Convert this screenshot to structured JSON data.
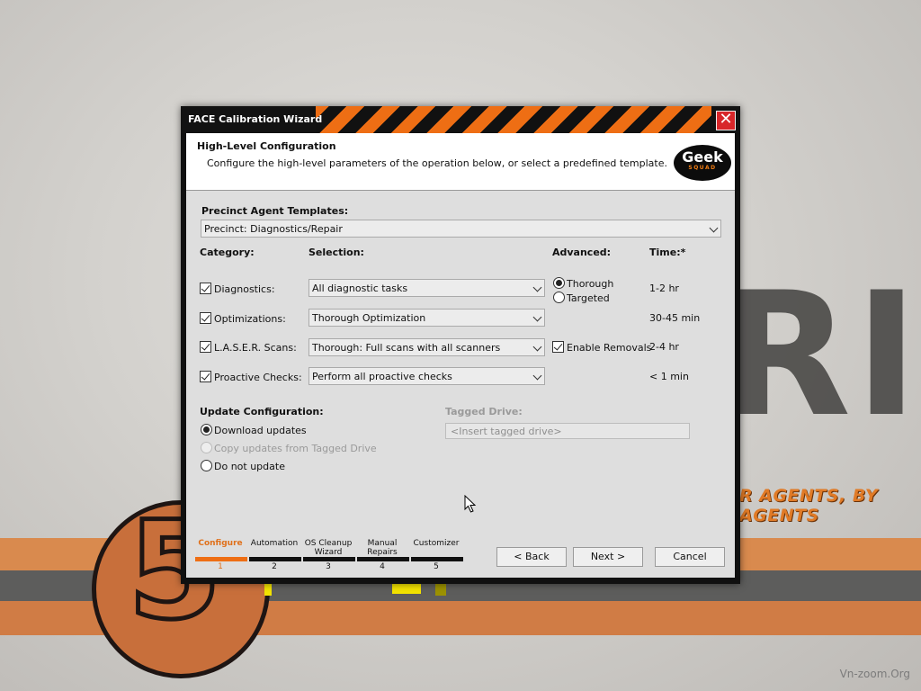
{
  "wallpaper": {
    "big_letters": "RI",
    "slogan": "R AGENTS, BY AGENTS",
    "circle_number": "5",
    "watermark": "Vn-zoom.Org"
  },
  "window": {
    "title": "FACE Calibration Wizard",
    "close_label": "✕"
  },
  "header": {
    "title": "High-Level Configuration",
    "description": "Configure the high-level parameters of the operation below, or select a predefined template.",
    "logo_main": "Geek",
    "logo_sub": "SQUAD"
  },
  "templates": {
    "label": "Precinct Agent Templates:",
    "selected": "Precinct: Diagnostics/Repair"
  },
  "columns": {
    "category": "Category:",
    "selection": "Selection:",
    "advanced": "Advanced:",
    "time": "Time:*"
  },
  "rows": [
    {
      "category": "Diagnostics:",
      "checked": true,
      "selection": "All diagnostic tasks",
      "time": "1-2 hr"
    },
    {
      "category": "Optimizations:",
      "checked": true,
      "selection": "Thorough Optimization",
      "time": "30-45 min"
    },
    {
      "category": "L.A.S.E.R. Scans:",
      "checked": true,
      "selection": "Thorough: Full scans with all scanners",
      "time": "2-4 hr"
    },
    {
      "category": "Proactive Checks:",
      "checked": true,
      "selection": "Perform all proactive checks",
      "time": "< 1 min"
    }
  ],
  "advanced": {
    "thorough": "Thorough",
    "targeted": "Targeted",
    "selected": "Thorough",
    "enable_removals": "Enable Removals",
    "enable_removals_checked": true
  },
  "update_config": {
    "label": "Update Configuration:",
    "options": [
      {
        "label": "Download updates",
        "selected": true,
        "enabled": true
      },
      {
        "label": "Copy updates from Tagged Drive",
        "selected": false,
        "enabled": false
      },
      {
        "label": "Do not update",
        "selected": false,
        "enabled": true
      }
    ]
  },
  "tagged_drive": {
    "label": "Tagged Drive:",
    "placeholder": "<Insert tagged drive>"
  },
  "steps": [
    {
      "label": "Configure",
      "number": "1",
      "active": true
    },
    {
      "label": "Automation",
      "number": "2",
      "active": false
    },
    {
      "label": "OS Cleanup Wizard",
      "number": "3",
      "active": false
    },
    {
      "label": "Manual Repairs",
      "number": "4",
      "active": false
    },
    {
      "label": "Customizer",
      "number": "5",
      "active": false
    }
  ],
  "buttons": {
    "back": "< Back",
    "next": "Next >",
    "cancel": "Cancel"
  },
  "colors": {
    "accent": "#ee6e14",
    "titlebar": "#121212",
    "panel": "#dedede",
    "close": "#d8262a"
  }
}
